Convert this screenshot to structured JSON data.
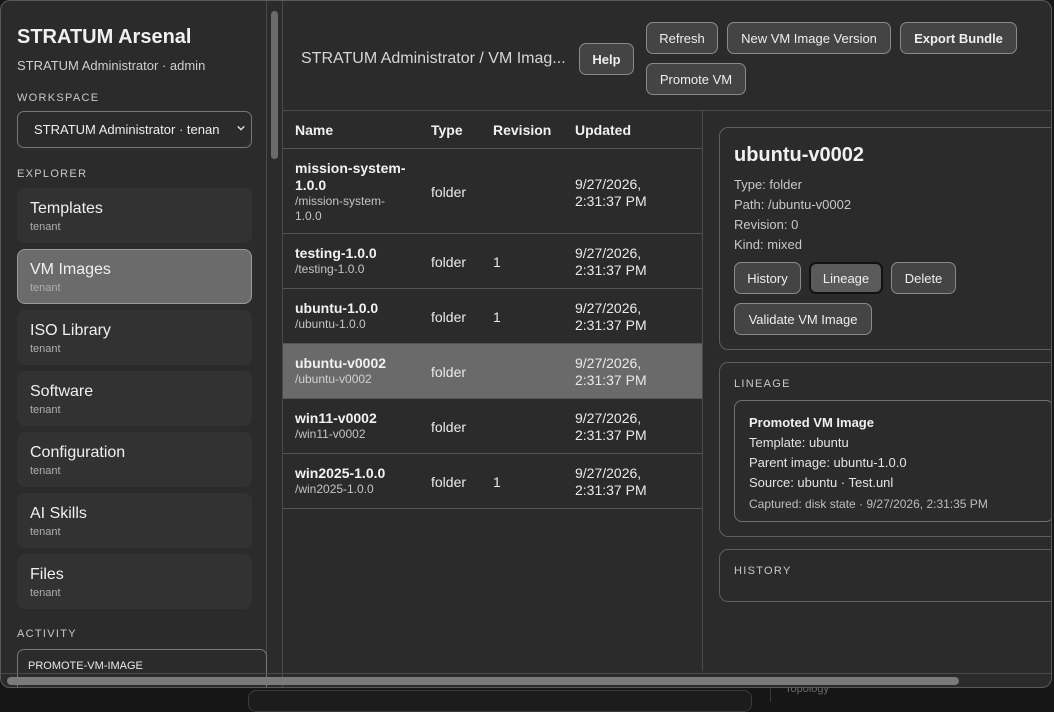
{
  "app": {
    "title": "STRATUM Arsenal",
    "subtitle": "STRATUM Administrator · admin"
  },
  "sidebar": {
    "workspace_label": "WORKSPACE",
    "workspace_value": "STRATUM Administrator · tenan",
    "explorer_label": "EXPLORER",
    "items": [
      {
        "label": "Templates",
        "sub": "tenant"
      },
      {
        "label": "VM Images",
        "sub": "tenant"
      },
      {
        "label": "ISO Library",
        "sub": "tenant"
      },
      {
        "label": "Software",
        "sub": "tenant"
      },
      {
        "label": "Configuration",
        "sub": "tenant"
      },
      {
        "label": "AI Skills",
        "sub": "tenant"
      },
      {
        "label": "Files",
        "sub": "tenant"
      }
    ],
    "activity_label": "ACTIVITY",
    "activity_item": "PROMOTE-VM-IMAGE"
  },
  "header": {
    "breadcrumb": "STRATUM Administrator / VM Imag...",
    "help": "Help",
    "refresh": "Refresh",
    "new_version": "New VM Image Version",
    "export": "Export Bundle",
    "promote": "Promote VM"
  },
  "table": {
    "columns": [
      "Name",
      "Type",
      "Revision",
      "Updated"
    ],
    "rows": [
      {
        "name": "mission-system-1.0.0",
        "path": "/mission-system-1.0.0",
        "type": "folder",
        "revision": "",
        "updated": "9/27/2026, 2:31:37 PM"
      },
      {
        "name": "testing-1.0.0",
        "path": "/testing-1.0.0",
        "type": "folder",
        "revision": "1",
        "updated": "9/27/2026, 2:31:37 PM"
      },
      {
        "name": "ubuntu-1.0.0",
        "path": "/ubuntu-1.0.0",
        "type": "folder",
        "revision": "1",
        "updated": "9/27/2026, 2:31:37 PM"
      },
      {
        "name": "ubuntu-v0002",
        "path": "/ubuntu-v0002",
        "type": "folder",
        "revision": "",
        "updated": "9/27/2026, 2:31:37 PM"
      },
      {
        "name": "win11-v0002",
        "path": "/win11-v0002",
        "type": "folder",
        "revision": "",
        "updated": "9/27/2026, 2:31:37 PM"
      },
      {
        "name": "win2025-1.0.0",
        "path": "/win2025-1.0.0",
        "type": "folder",
        "revision": "1",
        "updated": "9/27/2026, 2:31:37 PM"
      }
    ]
  },
  "detail": {
    "title": "ubuntu-v0002",
    "type": "Type: folder",
    "path": "Path: /ubuntu-v0002",
    "revision": "Revision: 0",
    "kind": "Kind: mixed",
    "btn_history": "History",
    "btn_lineage": "Lineage",
    "btn_delete": "Delete",
    "btn_validate": "Validate VM Image",
    "lineage_label": "LINEAGE",
    "lineage": {
      "title": "Promoted VM Image",
      "template": "Template: ubuntu",
      "parent": "Parent image: ubuntu-1.0.0",
      "source": "Source: ubuntu · Test.unl",
      "captured": "Captured: disk state · 9/27/2026, 2:31:35 PM"
    },
    "history_label": "HISTORY"
  },
  "background": {
    "hint_text": "Topology"
  }
}
